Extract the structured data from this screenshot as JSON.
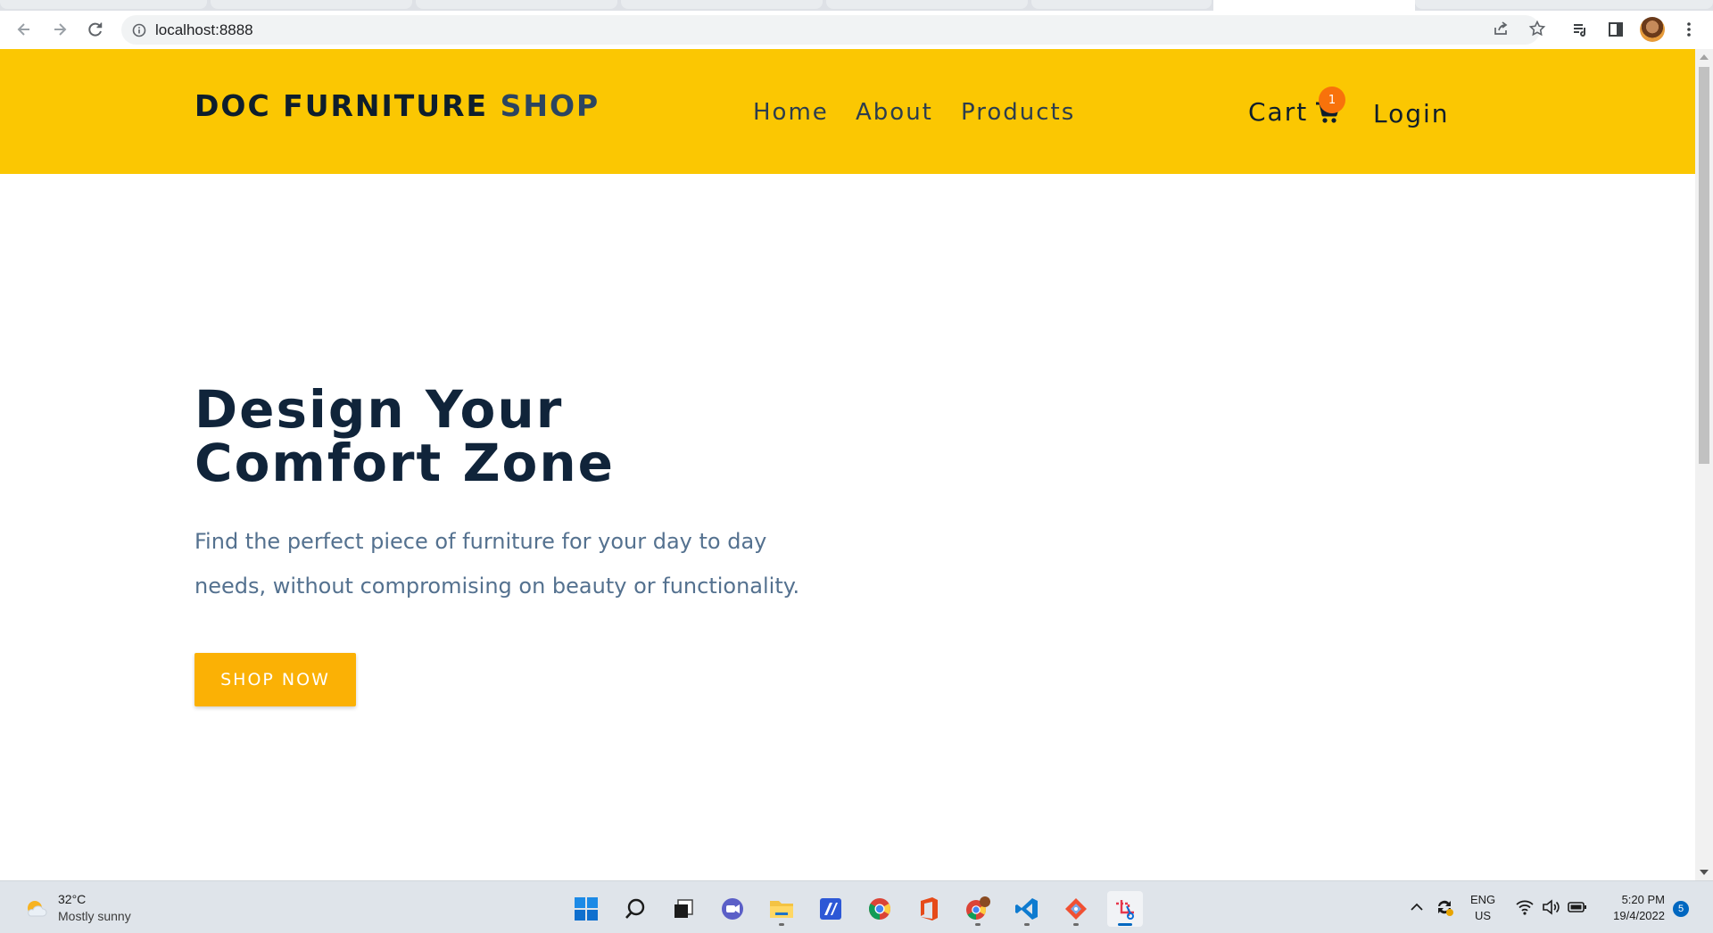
{
  "browser": {
    "url": "localhost:8888"
  },
  "site": {
    "brand_main": "DOC FURNITURE",
    "brand_accent": "SHOP",
    "nav": [
      {
        "label": "Home"
      },
      {
        "label": "About"
      },
      {
        "label": "Products"
      }
    ],
    "cart_label": "Cart",
    "cart_count": "1",
    "login_label": "Login",
    "colors": {
      "header_bg": "#fbc702",
      "button_bg": "#fbb105",
      "badge_bg": "#f8720b",
      "heading": "#10243a",
      "body_text": "#54718f"
    }
  },
  "hero": {
    "title_line1": "Design Your",
    "title_line2": "Comfort Zone",
    "text": "Find the perfect piece of furniture for your day to day needs, without compromising on beauty or functionality.",
    "button_label": "SHOP NOW"
  },
  "taskbar": {
    "weather_temp": "32°C",
    "weather_desc": "Mostly sunny",
    "apps": [
      "start-icon",
      "search-icon",
      "task-view-icon",
      "teams-chat-icon",
      "file-explorer-icon",
      "editor-app-icon",
      "chrome-icon",
      "office-icon",
      "chrome-profile-icon",
      "vscode-icon",
      "git-tool-icon",
      "snipping-tool-icon"
    ],
    "lang_line1": "ENG",
    "lang_line2": "US",
    "time": "5:20 PM",
    "date": "19/4/2022",
    "notifications": "5"
  }
}
